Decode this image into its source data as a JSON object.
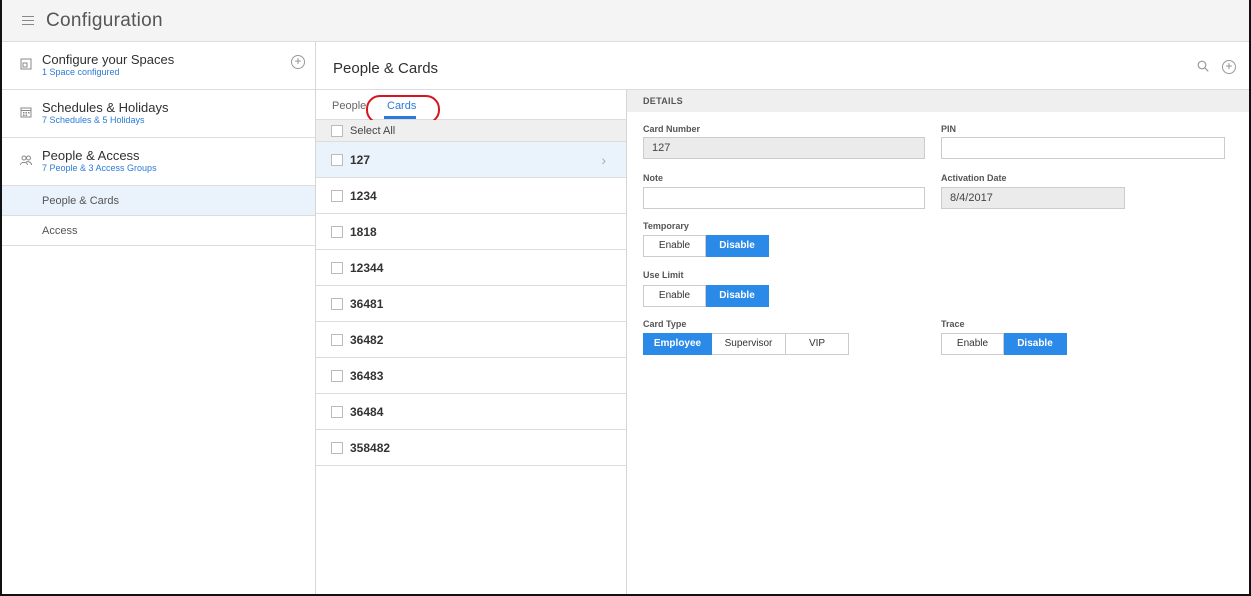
{
  "app": {
    "title": "Configuration"
  },
  "sidebar": {
    "sections": [
      {
        "title": "Configure your Spaces",
        "subtitle": "1 Space configured",
        "icon": "space-icon"
      },
      {
        "title": "Schedules & Holidays",
        "subtitle": "7 Schedules & 5 Holidays",
        "icon": "calendar-icon"
      },
      {
        "title": "People & Access",
        "subtitle": "7 People & 3 Access Groups",
        "icon": "people-icon"
      }
    ],
    "items": [
      {
        "label": "People & Cards",
        "active": true
      },
      {
        "label": "Access",
        "active": false
      }
    ]
  },
  "header": {
    "title": "People & Cards"
  },
  "tabs": {
    "people": "People",
    "cards": "Cards"
  },
  "list": {
    "select_all": "Select All",
    "rows": [
      "127",
      "1234",
      "1818",
      "12344",
      "36481",
      "36482",
      "36483",
      "36484",
      "358482"
    ],
    "selected": "127"
  },
  "details": {
    "header": "DETAILS",
    "card_number": {
      "label": "Card Number",
      "value": "127"
    },
    "pin": {
      "label": "PIN",
      "value": ""
    },
    "note": {
      "label": "Note",
      "value": ""
    },
    "activation_date": {
      "label": "Activation Date",
      "value": "8/4/2017"
    },
    "temporary": {
      "label": "Temporary",
      "options": [
        "Enable",
        "Disable"
      ],
      "selected": "Disable"
    },
    "use_limit": {
      "label": "Use Limit",
      "options": [
        "Enable",
        "Disable"
      ],
      "selected": "Disable"
    },
    "card_type": {
      "label": "Card Type",
      "options": [
        "Employee",
        "Supervisor",
        "VIP"
      ],
      "selected": "Employee"
    },
    "trace": {
      "label": "Trace",
      "options": [
        "Enable",
        "Disable"
      ],
      "selected": "Disable"
    }
  },
  "colors": {
    "accent": "#2b8ae8",
    "link": "#2b7bd6",
    "highlight": "#d8141e",
    "active_row": "#eaf3fb"
  }
}
